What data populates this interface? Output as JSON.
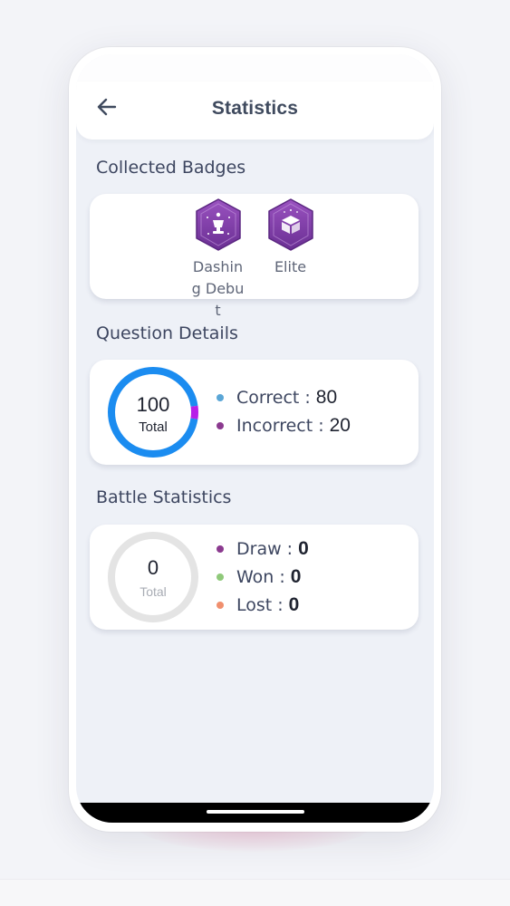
{
  "header": {
    "title": "Statistics",
    "back_icon": "arrow-left-icon"
  },
  "badges": {
    "section_title": "Collected Badges",
    "items": [
      {
        "label": "Dashing Debut",
        "icon": "trophy-hexagon-icon",
        "color": "#7b3fa6"
      },
      {
        "label": "Elite",
        "icon": "elite-box-hexagon-icon",
        "color": "#7b3fa6"
      }
    ]
  },
  "questions": {
    "section_title": "Question Details",
    "total": "100",
    "total_label": "Total",
    "correct_label": "Correct :",
    "correct_value": "80",
    "correct_color": "#5aa6d6",
    "incorrect_label": "Incorrect :",
    "incorrect_value": "20",
    "incorrect_color": "#8b3a8f",
    "ring_colors": {
      "main": "#1b8cf0",
      "accent": "#b81fe8"
    },
    "correct_fraction": 0.8,
    "incorrect_fraction": 0.2
  },
  "battle": {
    "section_title": "Battle Statistics",
    "total": "0",
    "total_label": "Total",
    "draw_label": "Draw :",
    "draw_value": "0",
    "draw_color": "#8b3a8f",
    "won_label": "Won :",
    "won_value": "0",
    "won_color": "#8fc97a",
    "lost_label": "Lost :",
    "lost_value": "0",
    "lost_color": "#f08f6e",
    "ring_color": "#e4e4e4"
  }
}
